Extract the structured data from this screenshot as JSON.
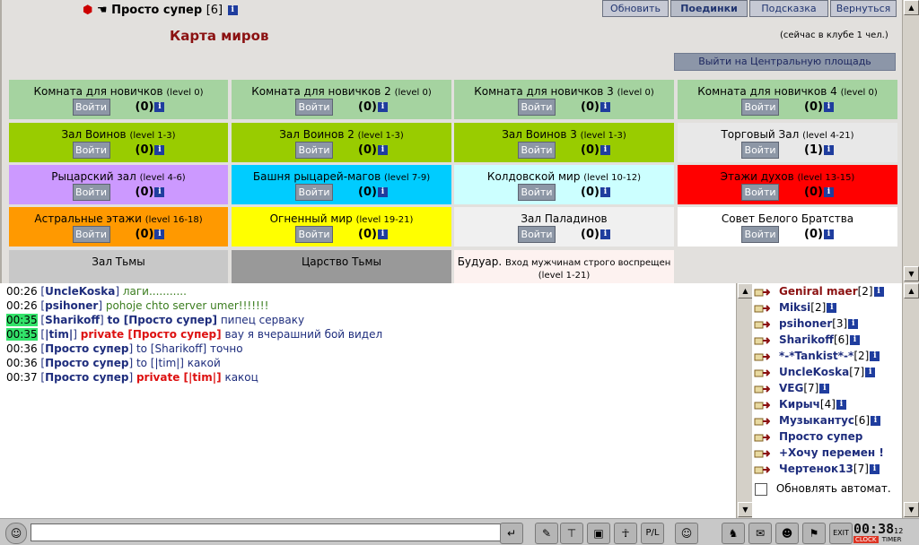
{
  "header": {
    "user_name": "Просто супер",
    "user_level": "[6]",
    "title": "Карта миров",
    "club_status": "(сейчас в клубе 1 чел.)",
    "exit_button": "Выйти на Центральную площадь",
    "nav": [
      "Обновить",
      "Поединки",
      "Подсказка",
      "Вернуться"
    ]
  },
  "rooms": [
    {
      "name": "Комната для новичков",
      "level": "(level 0)",
      "count": "(0)",
      "bg": "#a5d3a0"
    },
    {
      "name": "Комната для новичков 2",
      "level": "(level 0)",
      "count": "(0)",
      "bg": "#a5d3a0"
    },
    {
      "name": "Комната для новичков 3",
      "level": "(level 0)",
      "count": "(0)",
      "bg": "#a5d3a0"
    },
    {
      "name": "Комната для новичков 4",
      "level": "(level 0)",
      "count": "(0)",
      "bg": "#a5d3a0"
    },
    {
      "name": "Зал Воинов",
      "level": "(level 1-3)",
      "count": "(0)",
      "bg": "#99cc00"
    },
    {
      "name": "Зал Воинов 2",
      "level": "(level 1-3)",
      "count": "(0)",
      "bg": "#99cc00"
    },
    {
      "name": "Зал Воинов 3",
      "level": "(level 1-3)",
      "count": "(0)",
      "bg": "#99cc00"
    },
    {
      "name": "Торговый Зал",
      "level": "(level 4-21)",
      "count": "(1)",
      "bg": "#e8e8e8"
    },
    {
      "name": "Рыцарский зал",
      "level": "(level 4-6)",
      "count": "(0)",
      "bg": "#cc99ff"
    },
    {
      "name": "Башня рыцарей-магов",
      "level": "(level 7-9)",
      "count": "(0)",
      "bg": "#00ccff"
    },
    {
      "name": "Колдовской мир",
      "level": "(level 10-12)",
      "count": "(0)",
      "bg": "#ccffff"
    },
    {
      "name": "Этажи духов",
      "level": "(level 13-15)",
      "count": "(0)",
      "bg": "#ff0000"
    },
    {
      "name": "Астральные этажи",
      "level": "(level 16-18)",
      "count": "(0)",
      "bg": "#ff9900"
    },
    {
      "name": "Огненный мир",
      "level": "(level 19-21)",
      "count": "(0)",
      "bg": "#ffff00"
    },
    {
      "name": "Зал Паладинов",
      "level": "",
      "count": "(0)",
      "bg": "#f0f0f0"
    },
    {
      "name": "Совет Белого Братства",
      "level": "",
      "count": "(0)",
      "bg": "#ffffff"
    },
    {
      "name": "Зал Тьмы",
      "level": "",
      "count": "",
      "bg": "#c8c8c8"
    },
    {
      "name": "Царство Тьмы",
      "level": "",
      "count": "",
      "bg": "#999999"
    },
    {
      "name": "Будуар.",
      "level": "Вход мужчинам строго воспрещен (level 1-21)",
      "count": "",
      "bg": "#fdf2f0"
    }
  ],
  "enter_label": "Войти",
  "chat": [
    {
      "time": "00:26",
      "hl": false,
      "parts": [
        [
          "b",
          "["
        ],
        [
          "nk",
          "UncleKoska"
        ],
        [
          "b",
          "] "
        ],
        [
          "g",
          "лаги..........."
        ]
      ]
    },
    {
      "time": "00:26",
      "hl": false,
      "parts": [
        [
          "b",
          "["
        ],
        [
          "nk",
          "psihoner"
        ],
        [
          "b",
          "] "
        ],
        [
          "g",
          "pohoje chto server umer!!!!!!!"
        ]
      ]
    },
    {
      "time": "00:35",
      "hl": true,
      "parts": [
        [
          "b",
          "["
        ],
        [
          "nk",
          "Sharikoff"
        ],
        [
          "b",
          "] "
        ],
        [
          "nk",
          "to [Просто супер]"
        ],
        [
          "b",
          " пипец серваку"
        ]
      ]
    },
    {
      "time": "00:35",
      "hl": true,
      "parts": [
        [
          "b",
          "["
        ],
        [
          "nk",
          "|tim|"
        ],
        [
          "b",
          "] "
        ],
        [
          "pv",
          "private [Просто супер]"
        ],
        [
          "b",
          " вау я вчерашний бой видел"
        ]
      ]
    },
    {
      "time": "00:36",
      "hl": false,
      "parts": [
        [
          "b",
          "["
        ],
        [
          "nk",
          "Просто супер"
        ],
        [
          "b",
          "] "
        ],
        [
          "b",
          "to [Sharikoff] точно"
        ]
      ]
    },
    {
      "time": "00:36",
      "hl": false,
      "parts": [
        [
          "b",
          "["
        ],
        [
          "nk",
          "Просто супер"
        ],
        [
          "b",
          "] "
        ],
        [
          "b",
          "to [|tim|] какой"
        ]
      ]
    },
    {
      "time": "00:37",
      "hl": false,
      "parts": [
        [
          "b",
          "["
        ],
        [
          "nk",
          "Просто супер"
        ],
        [
          "b",
          "] "
        ],
        [
          "pv",
          "private [|tim|]"
        ],
        [
          "b",
          " какоц"
        ]
      ]
    }
  ],
  "users": [
    {
      "name": "Geniral maer",
      "lvl": "[2]",
      "red": true
    },
    {
      "name": "Miksi",
      "lvl": "[2]",
      "red": false
    },
    {
      "name": "psihoner",
      "lvl": "[3]",
      "red": false
    },
    {
      "name": "Sharikoff",
      "lvl": "[6]",
      "red": false
    },
    {
      "name": "*-*Tankist*-*",
      "lvl": "[2]",
      "red": false
    },
    {
      "name": "UncleKoska",
      "lvl": "[7]",
      "red": false
    },
    {
      "name": "VEG",
      "lvl": "[7]",
      "red": false
    },
    {
      "name": "Кирыч",
      "lvl": "[4]",
      "red": false
    },
    {
      "name": "Музыкантус",
      "lvl": "[6]",
      "red": false
    },
    {
      "name": "Просто супер",
      "lvl": "",
      "red": false
    },
    {
      "name": "+Хочу перемен !",
      "lvl": "",
      "red": false
    },
    {
      "name": "Чертенок13",
      "lvl": "[7]",
      "red": false
    }
  ],
  "auto_refresh_label": "Обновлять автомат.",
  "clock": {
    "time": "00:38",
    "sec": "12",
    "clock_label": "CLOCK",
    "timer_label": "TIMER"
  }
}
